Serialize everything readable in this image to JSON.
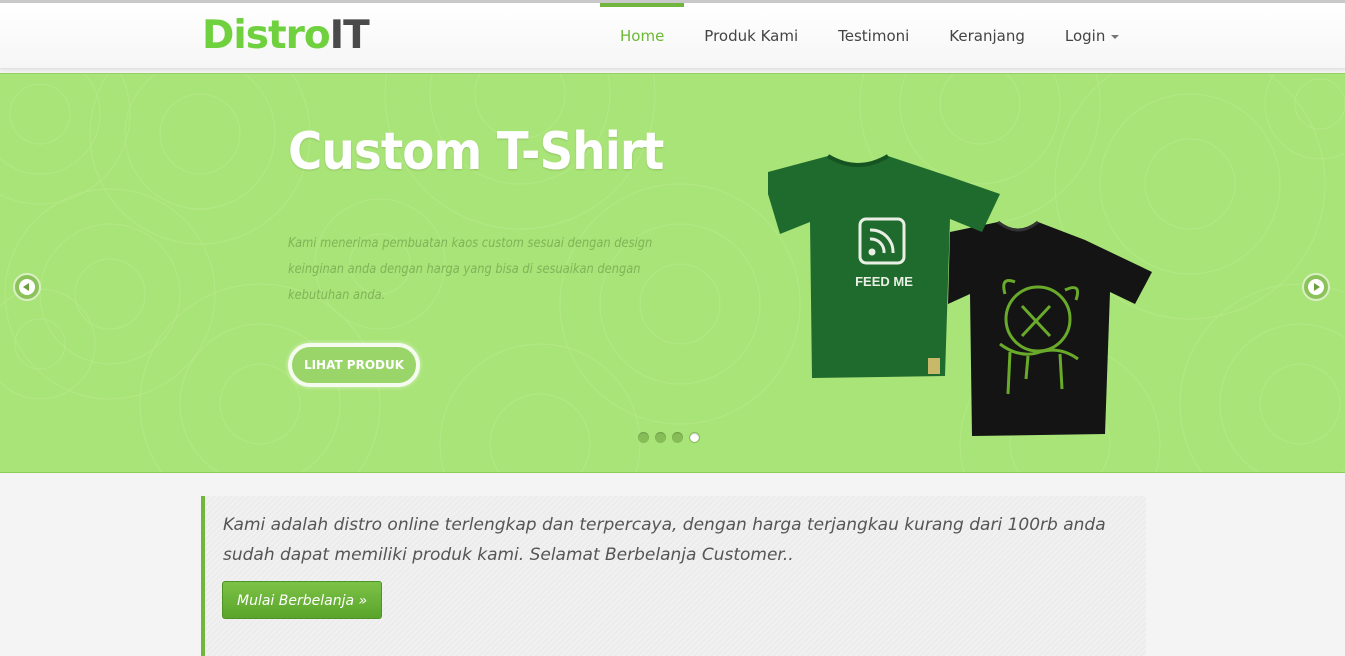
{
  "brand": {
    "part1": "Distro",
    "part2": "IT"
  },
  "nav": {
    "items": [
      {
        "label": "Home",
        "active": true
      },
      {
        "label": "Produk Kami"
      },
      {
        "label": "Testimoni"
      },
      {
        "label": "Keranjang"
      },
      {
        "label": "Login",
        "dropdown": true
      }
    ]
  },
  "slider": {
    "title": "Custom T-Shirt",
    "description": "Kami menerima pembuatan kaos custom sesuai dengan design keinginan anda dengan harga yang bisa di sesuaikan dengan kebutuhan anda.",
    "button_label": "LIHAT PRODUK",
    "slide_count": 4,
    "active_slide": 4,
    "shirt_text": "FEED ME",
    "prev_icon": "arrow-left-icon",
    "next_icon": "arrow-right-icon"
  },
  "welcome": {
    "text": "Kami adalah distro online terlengkap dan terpercaya, dengan harga terjangkau kurang dari 100rb anda sudah dapat memiliki produk kami. Selamat Berbelanja Customer..",
    "button_label": "Mulai Berbelanja »"
  },
  "colors": {
    "accent": "#72b63f",
    "brand_green": "#6fd13e",
    "hero_bg": "#a9e478"
  }
}
